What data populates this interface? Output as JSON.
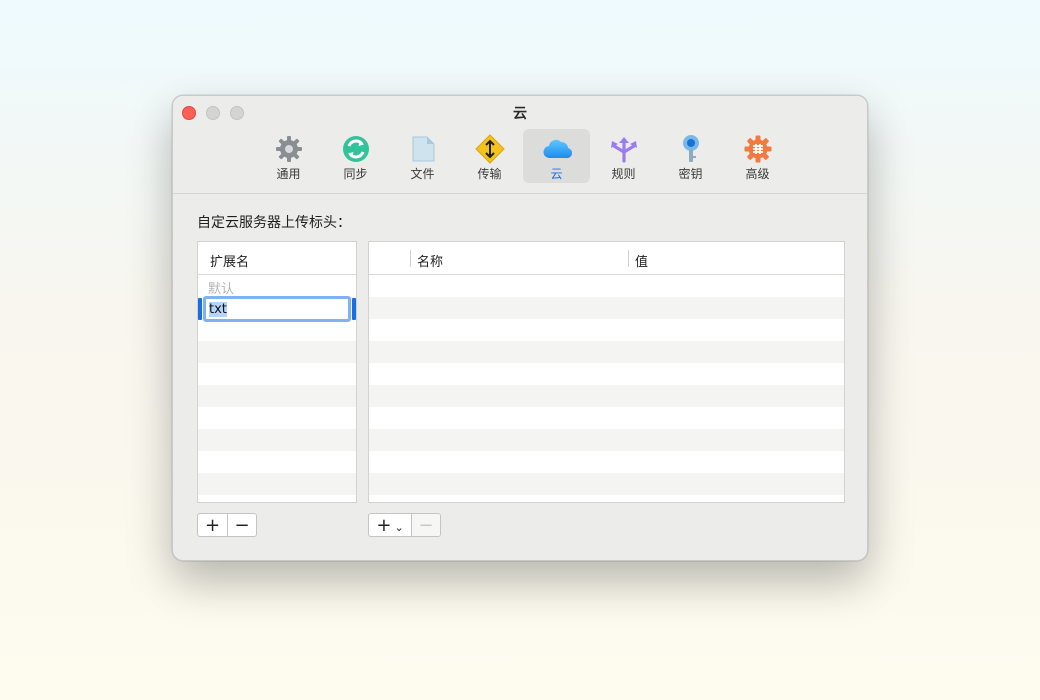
{
  "window": {
    "title": "云"
  },
  "toolbar": {
    "tabs": [
      {
        "label": "通用",
        "icon": "gear-icon"
      },
      {
        "label": "同步",
        "icon": "sync-icon"
      },
      {
        "label": "文件",
        "icon": "file-icon"
      },
      {
        "label": "传输",
        "icon": "transfer-icon"
      },
      {
        "label": "云",
        "icon": "cloud-icon",
        "active": true
      },
      {
        "label": "规则",
        "icon": "rules-icon"
      },
      {
        "label": "密钥",
        "icon": "key-icon"
      },
      {
        "label": "高级",
        "icon": "advanced-gear-icon"
      }
    ]
  },
  "main": {
    "section_label": "自定云服务器上传标头：",
    "extensions": {
      "header": "扩展名",
      "placeholder_row": "默认",
      "editing_value": "txt"
    },
    "headers_table": {
      "columns": [
        "",
        "名称",
        "值"
      ]
    },
    "buttons": {
      "add": "+",
      "remove": "−",
      "chevron": "⌄"
    }
  },
  "colors": {
    "accent": "#1a6fe0",
    "close": "#fe5f57",
    "selection": "#b4d4fb"
  }
}
